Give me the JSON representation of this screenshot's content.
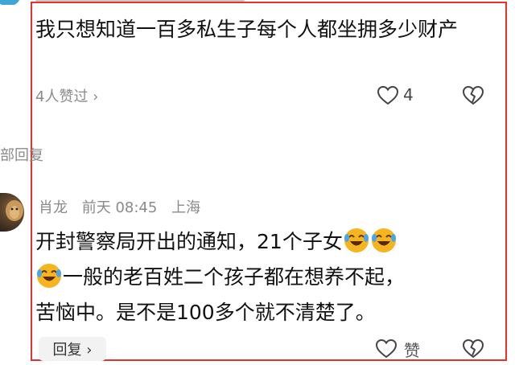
{
  "sidebar_reply_label": "部回复",
  "comment1": {
    "text": "我只想知道一百多私生子每个人都坐拥多少财产",
    "likes_label": "4人赞过 ›",
    "like_count": "4"
  },
  "comment2": {
    "author": "肖龙",
    "time": "前天 08:45",
    "location": "上海",
    "text_part1": "开封警察局开出的通知，21个子女",
    "text_part2": "一般的老百姓二个孩子都在想养不起，",
    "text_part3": "苦恼中。是不是100多个就不清楚了。",
    "reply_button": "回复 ›",
    "like_label": "赞"
  },
  "colors": {
    "frame_border": "#e8302e",
    "muted_text": "#8a8a8a",
    "emoji_yellow": "#f6b51e"
  },
  "icons": [
    "heart-outline-icon",
    "broken-heart-icon",
    "laughing-crying-emoji",
    "chevron-right-icon"
  ]
}
